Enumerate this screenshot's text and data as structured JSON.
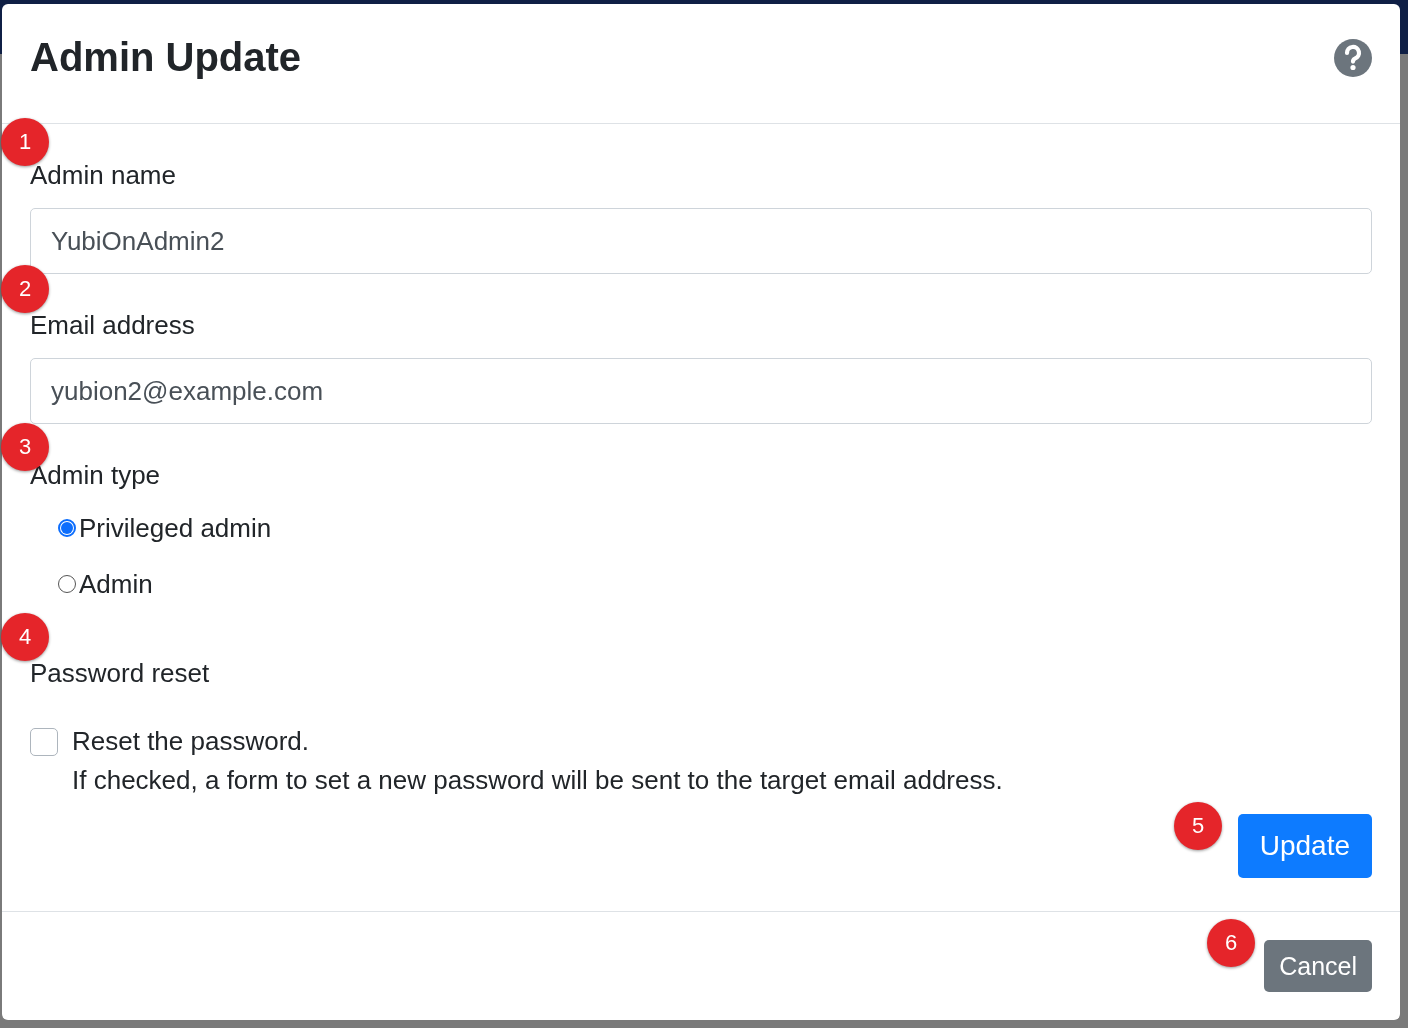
{
  "dialog": {
    "title": "Admin Update",
    "fields": [
      {
        "label": "Admin name",
        "value": "YubiOnAdmin2"
      },
      {
        "label": "Email address",
        "value": "yubion2@example.com"
      }
    ],
    "admin_type": {
      "label": "Admin type",
      "options": [
        {
          "label": "Privileged admin",
          "selected": true
        },
        {
          "label": "Admin",
          "selected": false
        }
      ]
    },
    "password_reset": {
      "label": "Password reset",
      "checkbox": {
        "label": "Reset the password.",
        "checked": false
      },
      "help": "If checked, a form to set a new password will be sent to the target email address."
    },
    "update_button": "Update",
    "cancel_button": "Cancel"
  },
  "callouts": [
    "1",
    "2",
    "3",
    "4",
    "5",
    "6"
  ]
}
